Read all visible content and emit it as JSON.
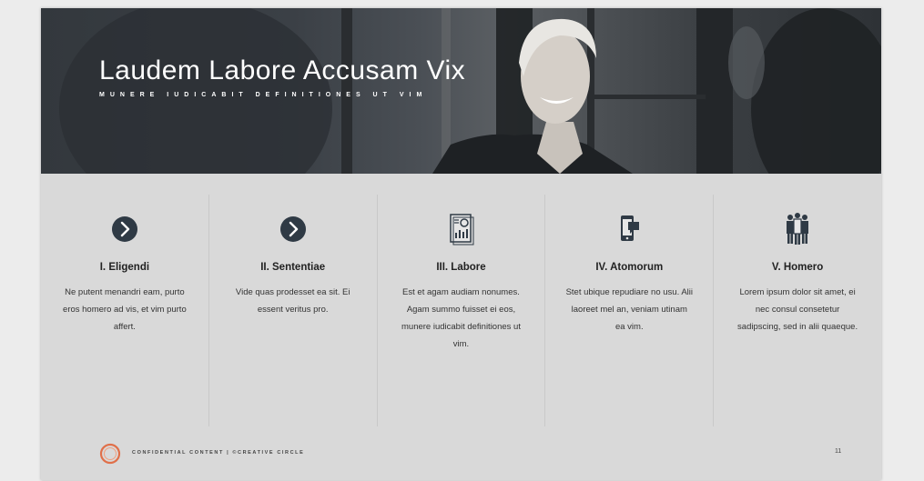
{
  "hero": {
    "title": "Laudem Labore Accusam Vix",
    "subtitle": "MUNERE IUDICABIT DEFINITIONES UT VIM"
  },
  "columns": [
    {
      "icon": "chevron-right-circle-icon",
      "title": "I. Eligendi",
      "body": "Ne putent menandri eam, purto eros homero ad vis, et vim purto affert."
    },
    {
      "icon": "chevron-right-circle-icon",
      "title": "II. Sententiae",
      "body": "Vide quas prodesset ea sit. Ei essent veritus pro."
    },
    {
      "icon": "report-document-icon",
      "title": "III. Labore",
      "body": "Est et agam audiam nonumes. Agam summo fuisset ei eos, munere iudicabit definitiones ut vim."
    },
    {
      "icon": "mobile-chat-icon",
      "title": "IV. Atomorum",
      "body": "Stet ubique repudiare no usu. Alii laoreet mel an, veniam utinam ea vim."
    },
    {
      "icon": "team-people-icon",
      "title": "V. Homero",
      "body": "Lorem ipsum dolor sit amet, ei nec consul consetetur sadipscing, sed in alii quaeque."
    }
  ],
  "footer": {
    "text": "CONFIDENTIAL CONTENT | ©CREATIVE CIRCLE",
    "page_number": "11"
  },
  "colors": {
    "accent_dark": "#2f3a45",
    "logo_orange": "#e0704a",
    "slide_bg": "#d9d9d9"
  }
}
